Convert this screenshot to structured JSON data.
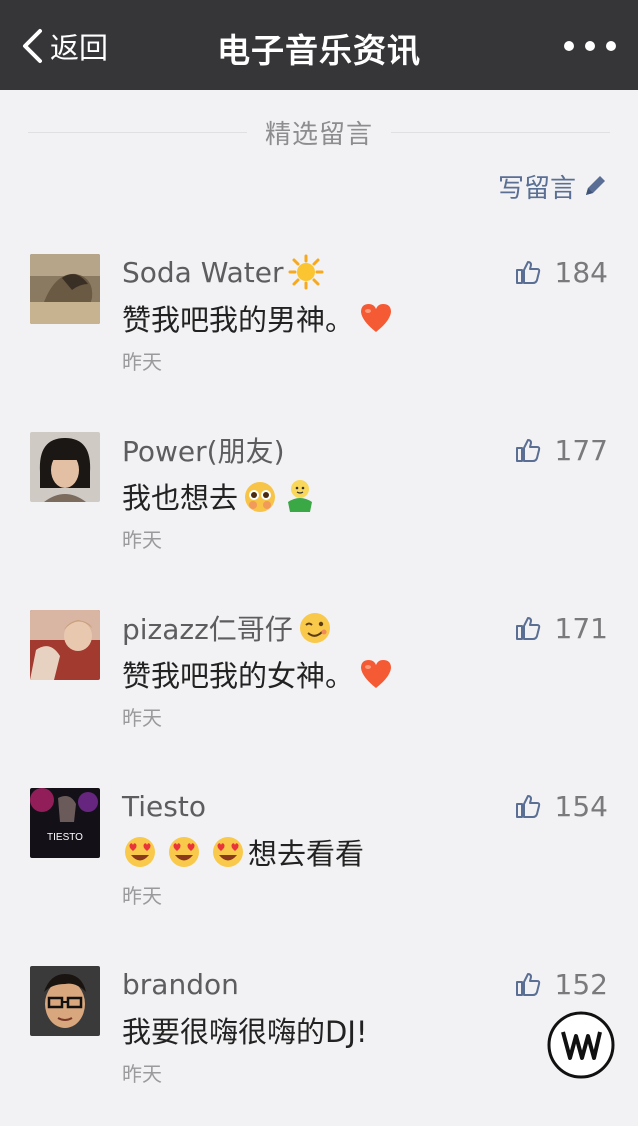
{
  "header": {
    "back_label": "返回",
    "title": "电子音乐资讯"
  },
  "section": {
    "label": "精选留言"
  },
  "write_comment_label": "写留言",
  "comments": [
    {
      "name": "Soda Water",
      "name_emoji": "sun",
      "likes": "184",
      "text": "赞我吧我的男神。",
      "emojis": [
        "heart"
      ],
      "time": "昨天",
      "avatar": "horse-photo"
    },
    {
      "name": "Power(朋友)",
      "name_emoji": "",
      "likes": "177",
      "text": "我也想去",
      "emojis": [
        "shy-face",
        "waving-figure"
      ],
      "time": "昨天",
      "avatar": "woman-photo"
    },
    {
      "name": "pizazz仁哥仔",
      "name_emoji": "wink",
      "likes": "171",
      "text": "赞我吧我的女神。",
      "emojis": [
        "heart"
      ],
      "time": "昨天",
      "avatar": "person-photo"
    },
    {
      "name": "Tiesto",
      "name_emoji": "",
      "likes": "154",
      "text": "想去看看",
      "emojis_before": [
        "heart-eyes",
        "heart-eyes",
        "heart-eyes"
      ],
      "time": "昨天",
      "avatar": "tiesto-logo"
    },
    {
      "name": "brandon",
      "name_emoji": "",
      "likes": "152",
      "text": "我要很嗨很嗨的DJ!",
      "emojis": [],
      "time": "昨天",
      "avatar": "man-glasses-photo"
    }
  ],
  "colors": {
    "header_bg": "#363639",
    "page_bg": "#f2f2f4",
    "link_blue": "#5a6f93"
  }
}
